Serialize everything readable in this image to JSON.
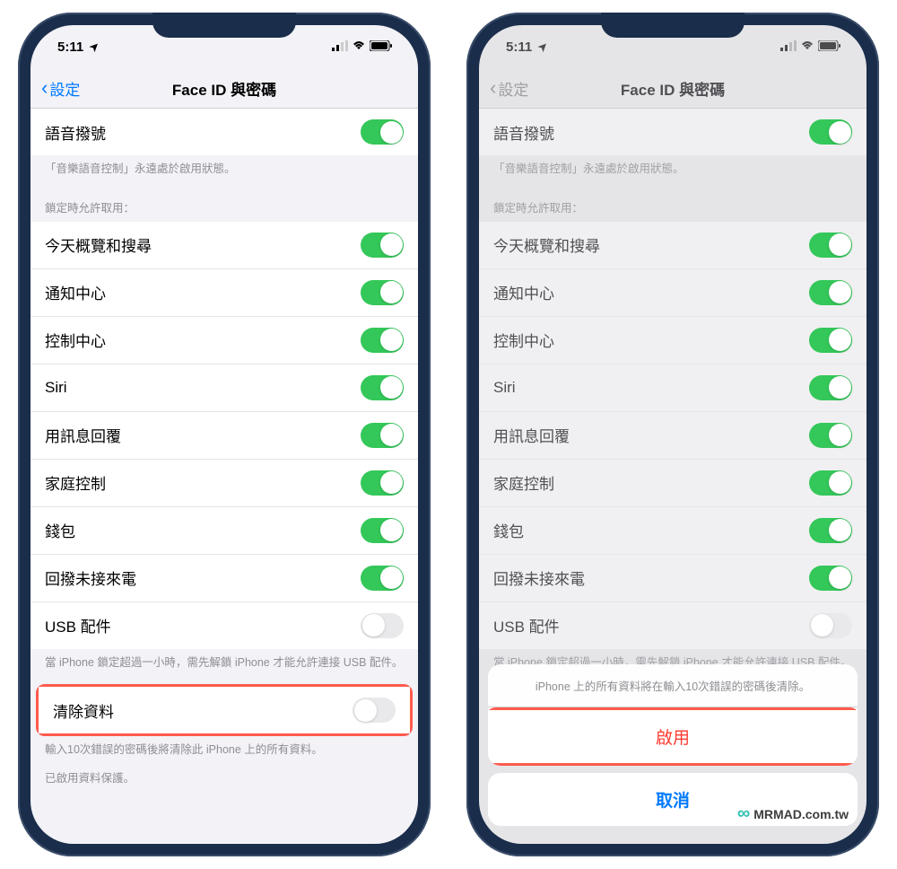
{
  "status": {
    "time": "5:11",
    "location_icon": "➤"
  },
  "nav": {
    "back": "設定",
    "title": "Face ID 與密碼"
  },
  "voice_dial": {
    "label": "語音撥號",
    "on": true
  },
  "voice_footer": "「音樂語音控制」永遠處於啟用狀態。",
  "lock_header": "鎖定時允許取用：",
  "lock_items": [
    {
      "label": "今天概覽和搜尋",
      "on": true
    },
    {
      "label": "通知中心",
      "on": true
    },
    {
      "label": "控制中心",
      "on": true
    },
    {
      "label": "Siri",
      "on": true
    },
    {
      "label": "用訊息回覆",
      "on": true
    },
    {
      "label": "家庭控制",
      "on": true
    },
    {
      "label": "錢包",
      "on": true
    },
    {
      "label": "回撥未接來電",
      "on": true
    },
    {
      "label": "USB 配件",
      "on": false
    }
  ],
  "usb_footer": "當 iPhone 鎖定超過一小時，需先解鎖 iPhone 才能允許連接 USB 配件。",
  "erase": {
    "label": "清除資料",
    "on": false
  },
  "erase_footer": "輸入10次錯誤的密碼後將清除此 iPhone 上的所有資料。",
  "protection_footer": "已啟用資料保護。",
  "sheet": {
    "message": "iPhone 上的所有資料將在輸入10次錯誤的密碼後清除。",
    "enable": "啟用",
    "cancel": "取消"
  },
  "watermark": "MRMAD.com.tw"
}
